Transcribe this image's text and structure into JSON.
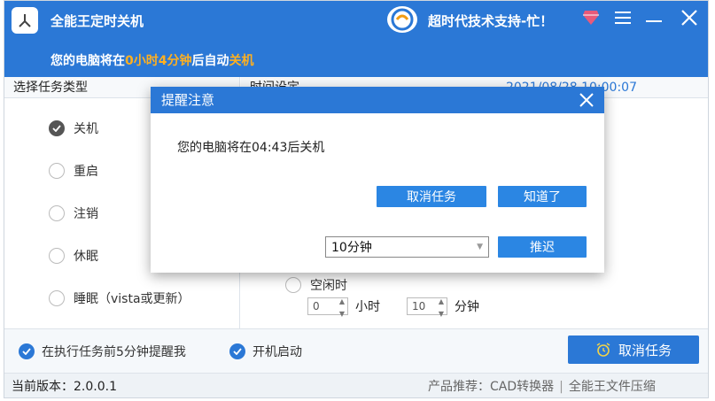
{
  "app": {
    "title": "全能王定时关机",
    "support_text": "超时代技术支持-忙！",
    "status_prefix": "您的电脑将在",
    "status_time": "0小时4分钟",
    "status_mid": "后自动",
    "status_action": "关机"
  },
  "left_panel": {
    "header": "选择任务类型",
    "options": [
      {
        "label": "关机",
        "checked": true
      },
      {
        "label": "重启",
        "checked": false
      },
      {
        "label": "注销",
        "checked": false
      },
      {
        "label": "休眠",
        "checked": false
      },
      {
        "label": "睡眠（vista或更新）",
        "checked": false
      }
    ]
  },
  "right_panel": {
    "header": "时间设定",
    "datetime": "2021/08/28 10:00:07",
    "idle_label": "空闲时",
    "hours_value": "0",
    "hours_unit": "小时",
    "minutes_value": "10",
    "minutes_unit": "分钟"
  },
  "bottom": {
    "remind_label": "在执行任务前5分钟提醒我",
    "autostart_label": "开机启动",
    "cancel_task_label": "取消任务"
  },
  "footer": {
    "version": "当前版本：2.0.0.1",
    "recommend_prefix": "产品推荐：",
    "links": [
      "CAD转换器",
      "全能王文件压缩"
    ]
  },
  "modal": {
    "title": "提醒注意",
    "message": "您的电脑将在04:43后关机",
    "cancel_label": "取消任务",
    "ok_label": "知道了",
    "delay_select": "10分钟",
    "delay_label": "推迟"
  },
  "colors": {
    "accent": "#2b78d6",
    "highlight": "#ffb020"
  }
}
